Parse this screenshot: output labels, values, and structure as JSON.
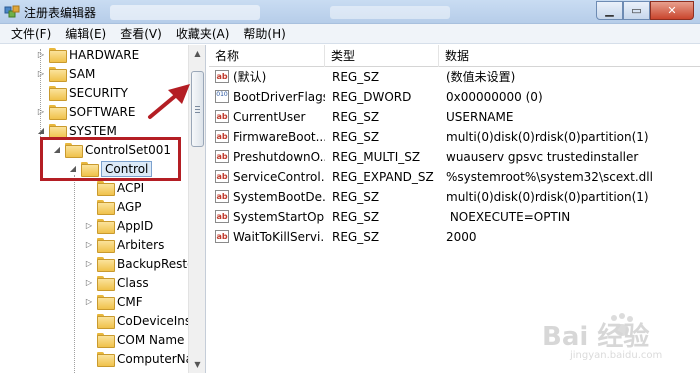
{
  "window": {
    "title": "注册表编辑器"
  },
  "menu": [
    "文件(F)",
    "编辑(E)",
    "查看(V)",
    "收藏夹(A)",
    "帮助(H)"
  ],
  "tree": [
    {
      "label": "HARDWARE",
      "expander": "▷"
    },
    {
      "label": "SAM",
      "expander": "▷"
    },
    {
      "label": "SECURITY",
      "expander": ""
    },
    {
      "label": "SOFTWARE",
      "expander": "▷"
    },
    {
      "label": "SYSTEM",
      "expander": "◢"
    },
    {
      "label": "ControlSet001",
      "expander": "◢"
    },
    {
      "label": "Control",
      "expander": "◢"
    },
    {
      "label": "ACPI",
      "expander": ""
    },
    {
      "label": "AGP",
      "expander": ""
    },
    {
      "label": "AppID",
      "expander": "▷"
    },
    {
      "label": "Arbiters",
      "expander": "▷"
    },
    {
      "label": "BackupRestore",
      "expander": "▷"
    },
    {
      "label": "Class",
      "expander": "▷"
    },
    {
      "label": "CMF",
      "expander": "▷"
    },
    {
      "label": "CoDeviceInstallers",
      "expander": ""
    },
    {
      "label": "COM Name Arbiter",
      "expander": ""
    },
    {
      "label": "ComputerName",
      "expander": ""
    }
  ],
  "columns": [
    "名称",
    "类型",
    "数据"
  ],
  "rows": [
    {
      "name": "(默认)",
      "type": "REG_SZ",
      "data": "(数值未设置)",
      "icon": "string-value-icon",
      "kind": "ab"
    },
    {
      "name": "BootDriverFlags",
      "type": "REG_DWORD",
      "data": "0x00000000 (0)",
      "icon": "binary-value-icon",
      "kind": "bin"
    },
    {
      "name": "CurrentUser",
      "type": "REG_SZ",
      "data": "USERNAME",
      "icon": "string-value-icon",
      "kind": "ab"
    },
    {
      "name": "FirmwareBoot...",
      "type": "REG_SZ",
      "data": "multi(0)disk(0)rdisk(0)partition(1)",
      "icon": "string-value-icon",
      "kind": "ab"
    },
    {
      "name": "PreshutdownO...",
      "type": "REG_MULTI_SZ",
      "data": "wuauserv gpsvc trustedinstaller",
      "icon": "string-value-icon",
      "kind": "ab"
    },
    {
      "name": "ServiceControl...",
      "type": "REG_EXPAND_SZ",
      "data": "%systemroot%\\system32\\scext.dll",
      "icon": "string-value-icon",
      "kind": "ab"
    },
    {
      "name": "SystemBootDe...",
      "type": "REG_SZ",
      "data": "multi(0)disk(0)rdisk(0)partition(1)",
      "icon": "string-value-icon",
      "kind": "ab"
    },
    {
      "name": "SystemStartOp...",
      "type": "REG_SZ",
      "data": " NOEXECUTE=OPTIN",
      "icon": "string-value-icon",
      "kind": "ab"
    },
    {
      "name": "WaitToKillServi...",
      "type": "REG_SZ",
      "data": "2000",
      "icon": "string-value-icon",
      "kind": "ab"
    }
  ],
  "icon_glyphs": {
    "ab": "ab",
    "bin": "010"
  },
  "watermark": {
    "brand": "Bai 经验",
    "url": "jingyan.baidu.com"
  },
  "colors": {
    "highlight": "#b41e24",
    "arrow": "#b41e24",
    "selection": "#dceaf8"
  }
}
